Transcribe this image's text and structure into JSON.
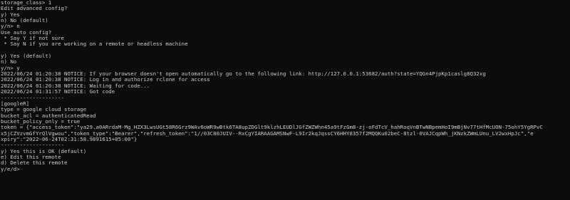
{
  "terminal": {
    "lines": [
      "storage_class> 1",
      "Edit advanced config?",
      "y) Yes",
      "n) No (default)",
      "y/n> n",
      "Use auto config?",
      " * Say Y if not sure",
      " * Say N if you are working on a remote or headless machine",
      "",
      "y) Yes (default)",
      "n) No",
      "y/n> y",
      "2022/06/24 01:20:38 NOTICE: If your browser doesn't open automatically go to the following link: http://127.0.0.1:53682/auth?state=YQGn4PjpKp1caslg8Q32xg",
      "2022/06/24 01:20:38 NOTICE: Log in and authorize rclone for access",
      "2022/06/24 01:20:38 NOTICE: Waiting for code...",
      "2022/06/24 01:31:57 NOTICE: Got code",
      "--------------------",
      "[googleR]",
      "type = google cloud storage",
      "bucket_acl = authenticatedRead",
      "bucket_policy_only = true",
      "token = {\"access_token\":\"ya29.a0ARrdaM-Mg_HZX3LwsUGt58R6Grz9WAv6oWR9wBtk6TA8upZDGlt9klzhLEUDlJGfZWZWhn45a9tFzGm8-zj-oFdTcV_hahRoqVnBTwNBpemHoI9mBjNv77tHfMcUON-75ohY5YgRPvC",
      "x5jCZVzvmGfYrQlVgwou\",\"token_type\":\"Bearer\",\"refresh_token\":\"1//03C80JUIV--RxCgYIARAAGAMSNwF-L9Ir2kqJqssCY6HHY8357f2MQQKu02beC-8tzl-0VAJCqpWh_jKNzkZWmLUnu_LV2wxHpJc\",\"e",
      "xpiry\":\"2022-06-24T02:31:58.9891615+05:00\"}",
      "--------------------",
      "y) Yes this is OK (default)",
      "e) Edit this remote",
      "d) Delete this remote",
      "y/e/d>"
    ]
  }
}
